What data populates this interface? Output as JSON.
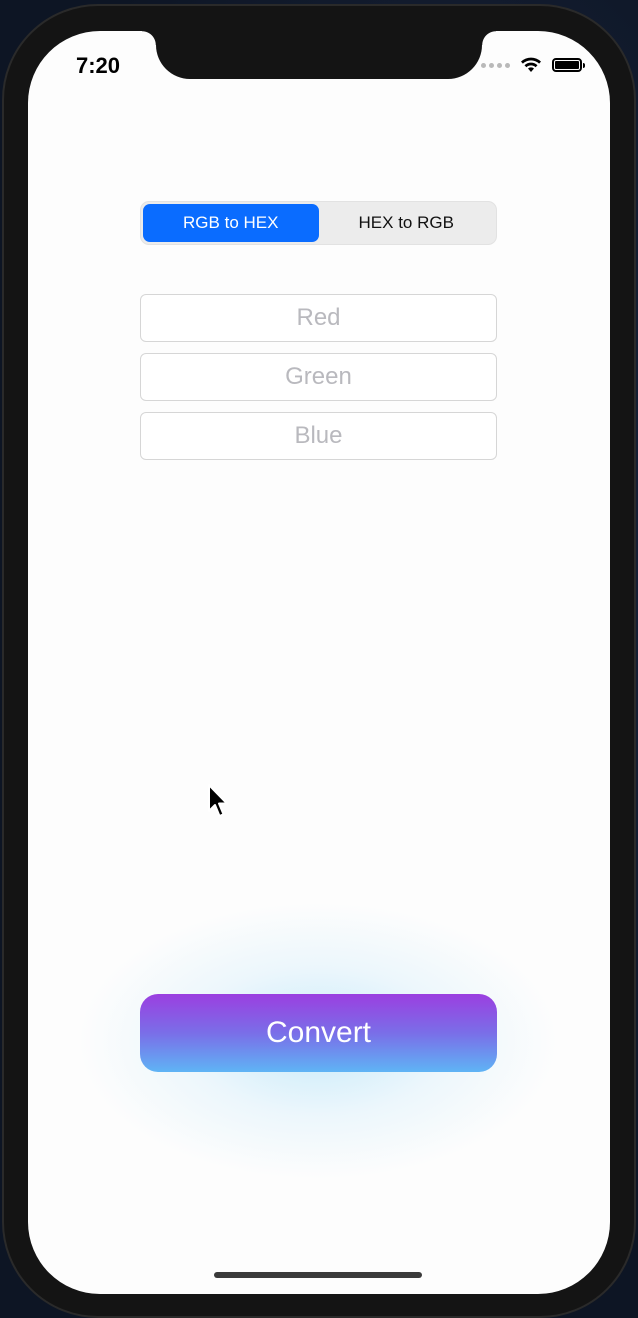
{
  "status_bar": {
    "time": "7:20",
    "icons": [
      "signal-dots-icon",
      "wifi-icon",
      "battery-icon"
    ]
  },
  "mode_selector": {
    "options": [
      "RGB to HEX",
      "HEX to RGB"
    ],
    "selected": "RGB to HEX"
  },
  "inputs": {
    "red": {
      "placeholder": "Red",
      "value": ""
    },
    "green": {
      "placeholder": "Green",
      "value": ""
    },
    "blue": {
      "placeholder": "Blue",
      "value": ""
    }
  },
  "actions": {
    "convert_label": "Convert"
  },
  "colors": {
    "accent": "#0a6cff",
    "button_gradient_top": "#9b3fe0",
    "button_gradient_bottom": "#5fb4f5",
    "screen_background": "#fdfdfd"
  }
}
